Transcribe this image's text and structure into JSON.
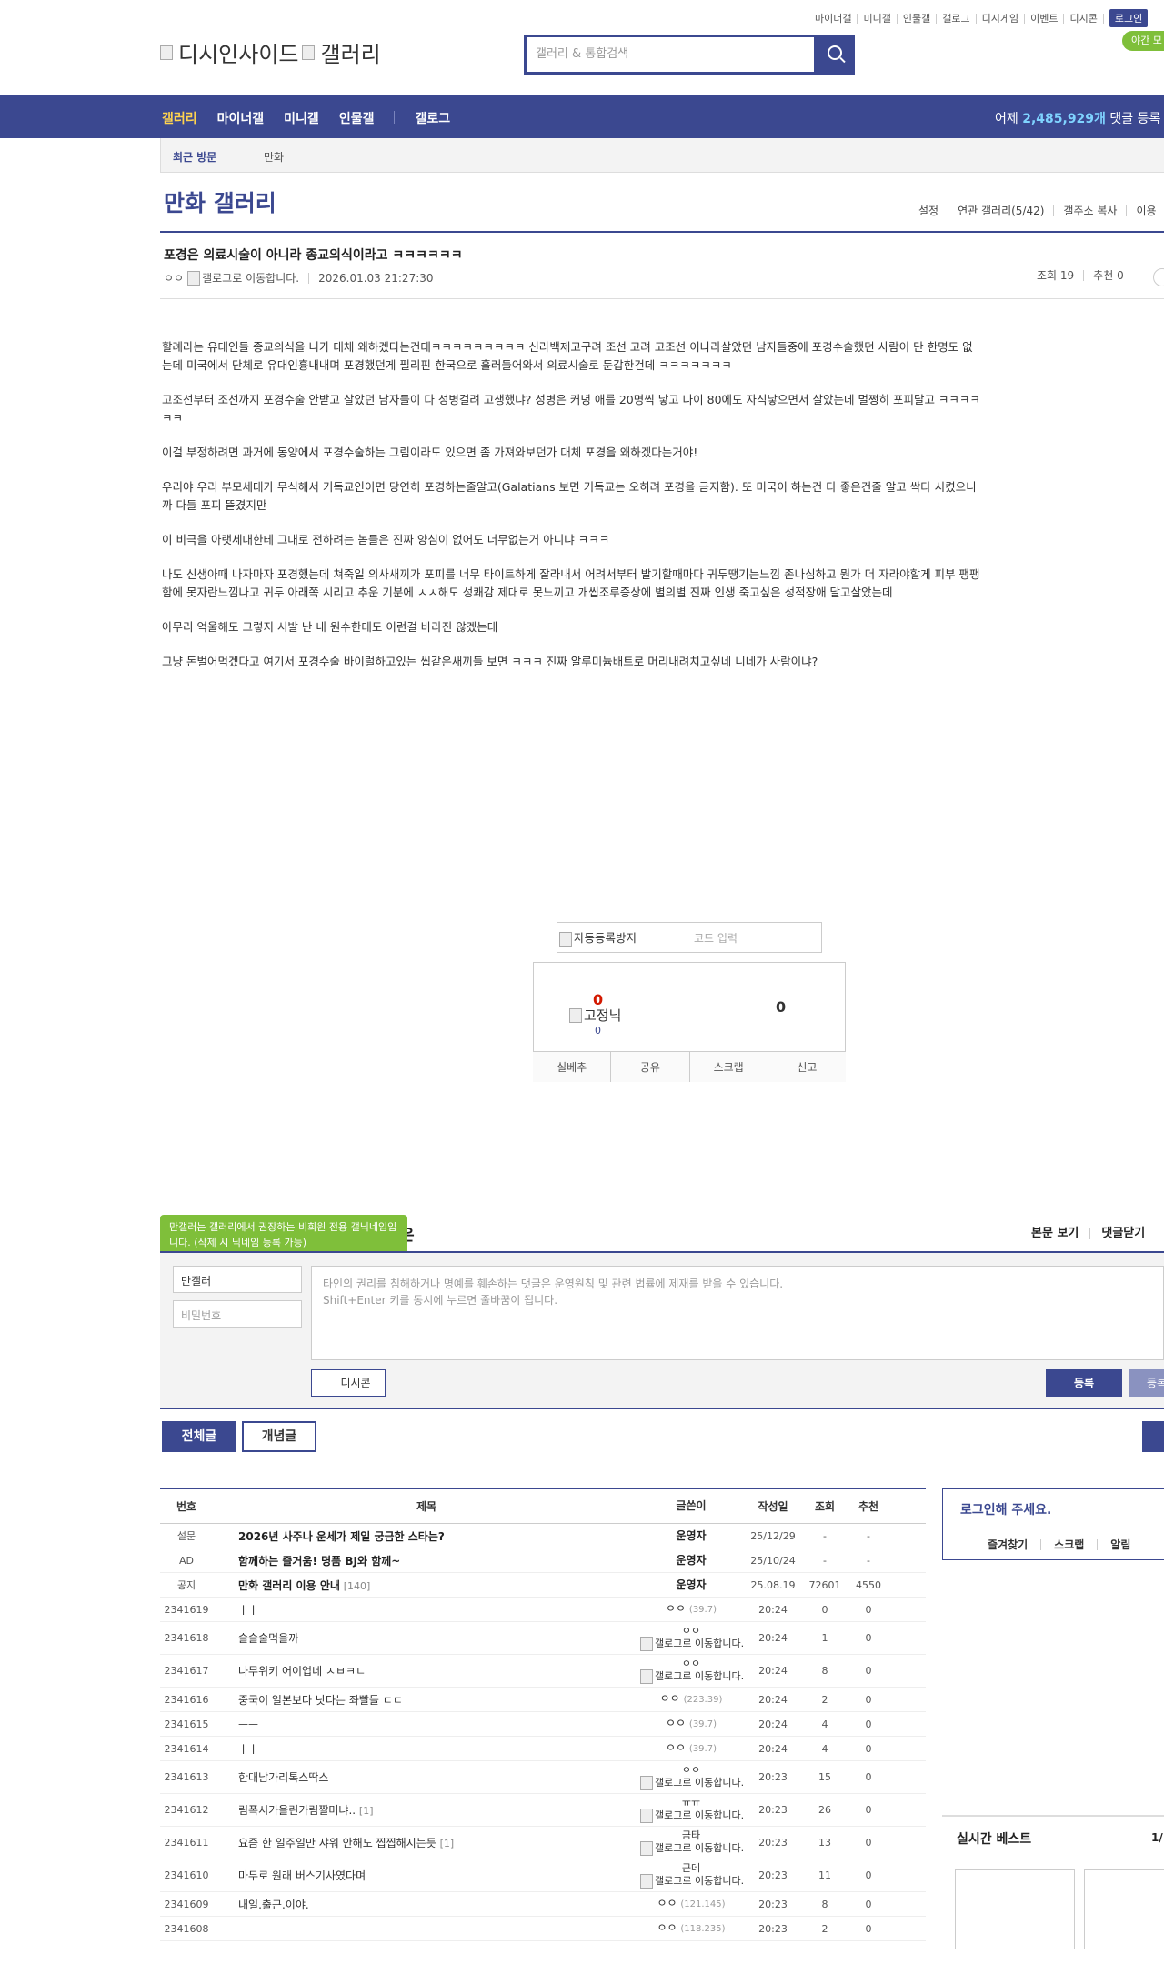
{
  "top_util": {
    "links": [
      "마이너갤",
      "미니갤",
      "인물갤",
      "갤로그",
      "디시게임",
      "이벤트",
      "디시콘"
    ],
    "login": "로그인",
    "night": "야간 모"
  },
  "logo": {
    "alt1": "디시인사이드",
    "alt2": "갤러리"
  },
  "search": {
    "placeholder": "갤러리 & 통합검색"
  },
  "nav": {
    "items": [
      "갤러리",
      "마이너갤",
      "미니갤",
      "인물갤"
    ],
    "gallog": "갤로그",
    "stats_prefix": "어제 ",
    "stats_num": "2,485,929개",
    "stats_suffix": " 댓글 등록"
  },
  "recent": {
    "title": "최근 방문",
    "item": "만화"
  },
  "gallery": {
    "title": "만화 갤러리",
    "menu": [
      "설정",
      "연관 갤러리(5/42)",
      "갤주소 복사",
      "이용"
    ]
  },
  "post": {
    "title": "포경은 의료시술이 아니라 종교의식이라고 ㅋㅋㅋㅋㅋㅋ",
    "author": "ㅇㅇ",
    "author_img_alt": "갤로그로 이동합니다.",
    "date": "2026.01.03 21:27:30",
    "views": "조회 19",
    "recs": "추천 0",
    "body": [
      "할례라는 유대인들 종교의식을 니가 대체 왜하겠다는건데ㅋㅋㅋㅋㅋㅋㅋㅋㅋ 신라백제고구려 조선 고려 고조선 이나라살았던 남자들중에 포경수술했던 사람이 단 한명도 없는데 미국에서 단체로 유대인흉내내며 포경했던게 필리핀-한국으로 흘러들어와서 의료시술로 둔갑한건데 ㅋㅋㅋㅋㅋㅋㅋ",
      "고조선부터 조선까지 포경수술 안받고 살았던 남자들이 다 성병걸려 고생했냐? 성병은 커녕 애를 20명씩 낳고 나이 80에도 자식낳으면서 살았는데 멀쩡히 포피달고 ㅋㅋㅋㅋㅋㅋ",
      "이걸 부정하려면 과거에 동양에서 포경수술하는 그림이라도 있으면 좀 가져와보던가 대체 포경을 왜하겠다는거야!",
      "우리야 우리 부모세대가 무식해서 기독교인이면 당연히 포경하는줄알고(Galatians 보면 기독교는 오히려 포경을 금지함). 또 미국이 하는건 다 좋은건줄 알고 싹다 시켰으니까 다들 포피 뜯겼지만",
      "이 비극을 아랫세대한테 그대로 전하려는 놈들은 진짜 양심이 없어도 너무없는거 아니냐 ㅋㅋㅋ",
      "나도 신생아때 나자마자 포경했는데 쳐죽일 의사새끼가 포피를 너무 타이트하게 잘라내서 어려서부터 발기할때마다 귀두땡기는느낌 존나심하고 뭔가 더 자라야할게 피부 팽팽함에 못자란느낌나고 귀두 아래쪽 시리고 추운 기분에 ㅅㅅ해도 성쾌감 제대로 못느끼고 개씹조루증상에 별의별 진짜 인생 죽고싶은 성적장애 달고살았는데",
      "아무리 억울해도 그렇지 시발 난 내 원수한테도 이런걸 바라진 않겠는데",
      "그냥 돈벌어먹겠다고 여기서 포경수술 바이럴하고있는 씹같은새끼들 보면 ㅋㅋㅋ 진짜 알루미늄배트로 머리내려치고싶네  니네가 사람이냐?"
    ]
  },
  "captcha": {
    "img_alt": "자동등록방지",
    "placeholder": "코드 입력"
  },
  "recommend": {
    "up": "0",
    "fixed_alt": "고정닉",
    "fixed_count": "0",
    "down": "0",
    "actions": [
      "실베추",
      "공유",
      "스크랩",
      "신고"
    ]
  },
  "comment": {
    "tooltip": "만갤러는 갤러리에서 권장하는 비회원 전용 갤닉네임입니다. (삭제 시 닉네임 등록 가능)",
    "heading_tail": "은",
    "tabs": [
      "본문 보기",
      "댓글닫기"
    ],
    "nick": "만갤러",
    "pw_placeholder": "비밀번호",
    "text_placeholder_1": "타인의 권리를 침해하거나 명예를 훼손하는 댓글은 운영원칙 및 관련 법률에 제재를 받을 수 있습니다.",
    "text_placeholder_2": "Shift+Enter 키를 동시에 누르면 줄바꿈이 됩니다.",
    "dccon": "디시콘",
    "submit": "등록",
    "submit2": "등록"
  },
  "list_tabs": {
    "all": "전체글",
    "concept": "개념글"
  },
  "list": {
    "headers": {
      "num": "번호",
      "title": "제목",
      "writer": "글쓴이",
      "date": "작성일",
      "view": "조회",
      "rec": "추천"
    },
    "rows": [
      {
        "num": "설문",
        "title": "2026년 사주나 운세가 제일 궁금한 스타는?",
        "reply": "",
        "writer": "운영자",
        "ip": "",
        "mark": "",
        "date": "25/12/29",
        "view": "-",
        "rec": "-",
        "bold": true,
        "tall": false
      },
      {
        "num": "AD",
        "title": "함께하는 즐거움! 명품 BJ와 함께~",
        "reply": "",
        "writer": "운영자",
        "ip": "",
        "mark": "",
        "date": "25/10/24",
        "view": "-",
        "rec": "-",
        "bold": true,
        "tall": false
      },
      {
        "num": "공지",
        "title": "만화 갤러리 이용 안내",
        "reply": "[140]",
        "writer": "운영자",
        "ip": "",
        "mark": "",
        "date": "25.08.19",
        "view": "72601",
        "rec": "4550",
        "bold": true,
        "tall": false
      },
      {
        "num": "2341619",
        "title": "ㅣㅣ",
        "reply": "",
        "writer": "ㅇㅇ",
        "ip": "(39.7)",
        "mark": "",
        "date": "20:24",
        "view": "0",
        "rec": "0",
        "bold": false,
        "tall": false
      },
      {
        "num": "2341618",
        "title": "슬슬술먹을까",
        "reply": "",
        "writer": "ㅇㅇ",
        "ip": "",
        "mark": "갤로그로 이동합니다.",
        "date": "20:24",
        "view": "1",
        "rec": "0",
        "bold": false,
        "tall": true
      },
      {
        "num": "2341617",
        "title": "나무위키 어이업네 ㅅㅂㅋㄴ",
        "reply": "",
        "writer": "ㅇㅇ",
        "ip": "",
        "mark": "갤로그로 이동합니다.",
        "date": "20:24",
        "view": "8",
        "rec": "0",
        "bold": false,
        "tall": true
      },
      {
        "num": "2341616",
        "title": "중국이 일본보다 낫다는 좌빨들 ㄷㄷ",
        "reply": "",
        "writer": "ㅇㅇ",
        "ip": "(223.39)",
        "mark": "",
        "date": "20:24",
        "view": "2",
        "rec": "0",
        "bold": false,
        "tall": false
      },
      {
        "num": "2341615",
        "title": "ㅡㅡ",
        "reply": "",
        "writer": "ㅇㅇ",
        "ip": "(39.7)",
        "mark": "",
        "date": "20:24",
        "view": "4",
        "rec": "0",
        "bold": false,
        "tall": false
      },
      {
        "num": "2341614",
        "title": "ㅣㅣ",
        "reply": "",
        "writer": "ㅇㅇ",
        "ip": "(39.7)",
        "mark": "",
        "date": "20:24",
        "view": "4",
        "rec": "0",
        "bold": false,
        "tall": false
      },
      {
        "num": "2341613",
        "title": "한대남가리톡스딱스",
        "reply": "",
        "writer": "ㅇㅇ",
        "ip": "",
        "mark": "갤로그로 이동합니다.",
        "date": "20:23",
        "view": "15",
        "rec": "0",
        "bold": false,
        "tall": true
      },
      {
        "num": "2341612",
        "title": "림폭시가올린가림짤머냐..",
        "reply": "[1]",
        "writer": "ㅠㅠ",
        "ip": "",
        "mark": "갤로그로 이동합니다.",
        "date": "20:23",
        "view": "26",
        "rec": "0",
        "bold": false,
        "tall": true
      },
      {
        "num": "2341611",
        "title": "요즘 한 일주일만 샤워 안해도 찝찝해지는듯",
        "reply": "[1]",
        "writer": "금타",
        "ip": "",
        "mark": "갤로그로 이동합니다.",
        "date": "20:23",
        "view": "13",
        "rec": "0",
        "bold": false,
        "tall": true
      },
      {
        "num": "2341610",
        "title": "마두로 원래 버스기사였다며",
        "reply": "",
        "writer": "근데",
        "ip": "",
        "mark": "갤로그로 이동합니다.",
        "date": "20:23",
        "view": "11",
        "rec": "0",
        "bold": false,
        "tall": true
      },
      {
        "num": "2341609",
        "title": "내일.출근.이야.",
        "reply": "",
        "writer": "ㅇㅇ",
        "ip": "(121.145)",
        "mark": "",
        "date": "20:23",
        "view": "8",
        "rec": "0",
        "bold": false,
        "tall": false
      },
      {
        "num": "2341608",
        "title": "ㅡㅡ",
        "reply": "",
        "writer": "ㅇㅇ",
        "ip": "(118.235)",
        "mark": "",
        "date": "20:23",
        "view": "2",
        "rec": "0",
        "bold": false,
        "tall": false
      }
    ]
  },
  "sidebar": {
    "login_title": "로그인해 주세요.",
    "login_links": [
      "즐겨찾기",
      "스크랩",
      "알림"
    ],
    "best_title": "실시간 베스트",
    "best_page": "1/"
  }
}
